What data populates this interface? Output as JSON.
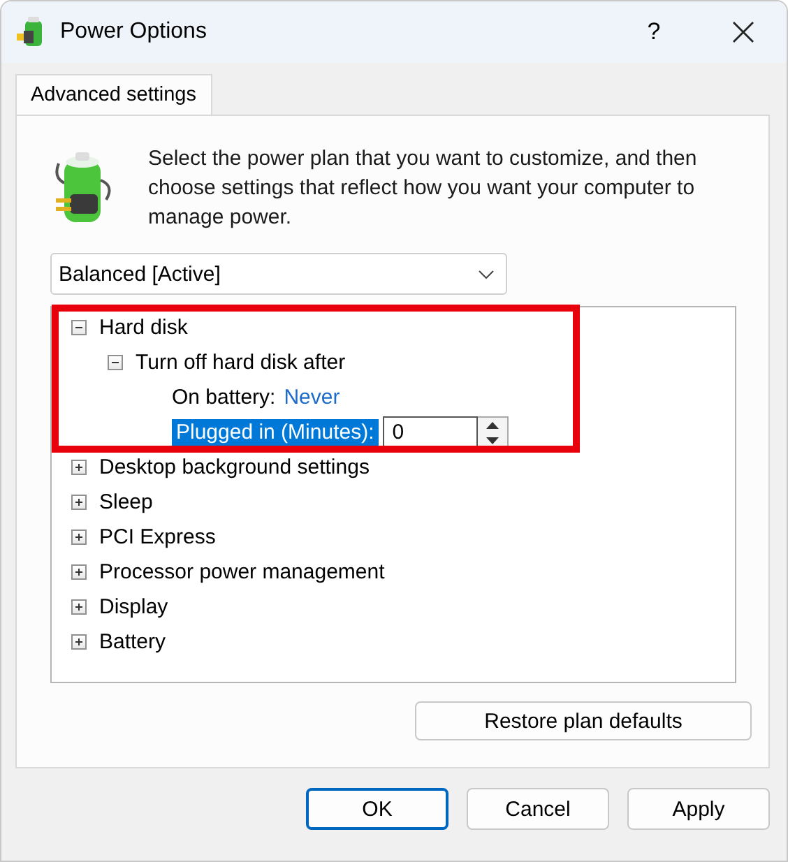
{
  "window": {
    "title": "Power Options",
    "help": "?"
  },
  "tabs": [
    {
      "label": "Advanced settings",
      "selected": true
    }
  ],
  "description": "Select the power plan that you want to customize, and then choose settings that reflect how you want your computer to manage power.",
  "plan_dropdown": {
    "value": "Balanced [Active]"
  },
  "tree": [
    {
      "label": "Hard disk",
      "expanded": true,
      "children": [
        {
          "label": "Turn off hard disk after",
          "expanded": true,
          "settings": [
            {
              "label": "On battery:",
              "kind": "link",
              "value": "Never",
              "selected": false
            },
            {
              "label": "Plugged in (Minutes):",
              "kind": "spin",
              "value": "0",
              "selected": true
            }
          ]
        }
      ]
    },
    {
      "label": "Desktop background settings",
      "expanded": false
    },
    {
      "label": "Sleep",
      "expanded": false
    },
    {
      "label": "PCI Express",
      "expanded": false
    },
    {
      "label": "Processor power management",
      "expanded": false
    },
    {
      "label": "Display",
      "expanded": false
    },
    {
      "label": "Battery",
      "expanded": false
    }
  ],
  "restore_button": "Restore plan defaults",
  "buttons": [
    {
      "label": "OK",
      "default": true
    },
    {
      "label": "Cancel",
      "default": false
    },
    {
      "label": "Apply",
      "default": false
    }
  ]
}
